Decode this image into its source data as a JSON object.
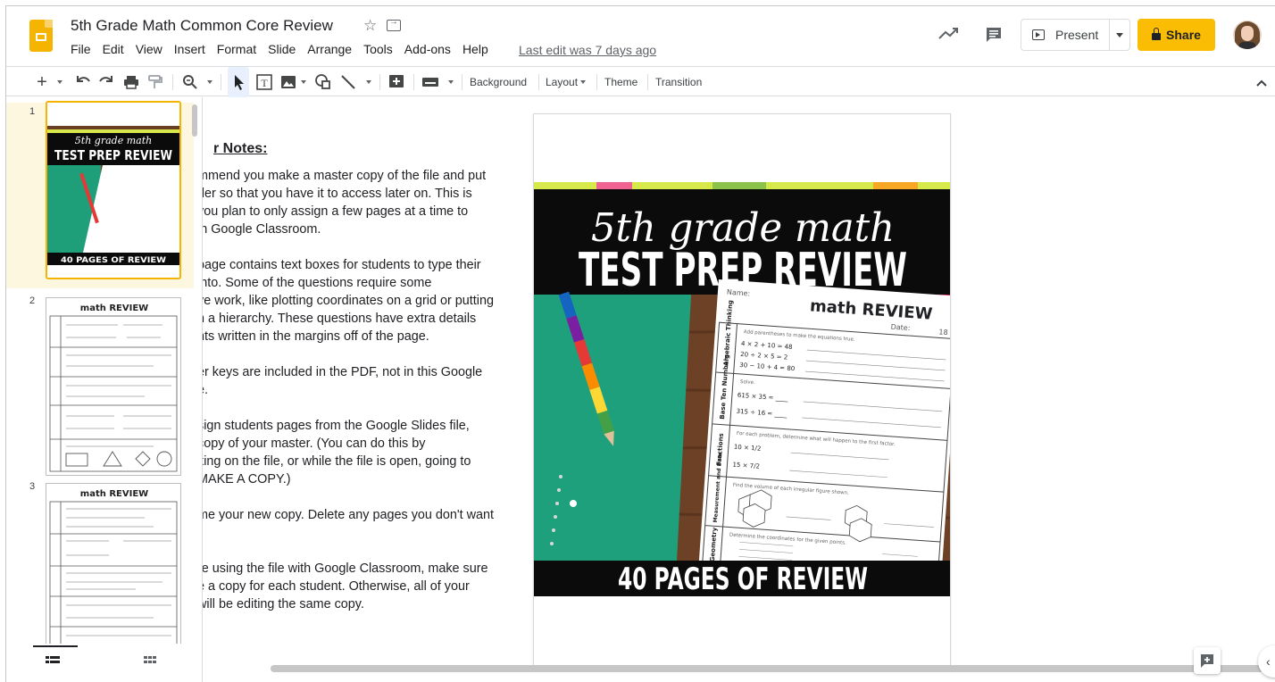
{
  "header": {
    "doc_title": "5th Grade Math Common Core Review",
    "menu": [
      "File",
      "Edit",
      "View",
      "Insert",
      "Format",
      "Slide",
      "Arrange",
      "Tools",
      "Add-ons",
      "Help"
    ],
    "last_edit": "Last edit was 7 days ago",
    "present_label": "Present",
    "share_label": "Share",
    "accent_color": "#fbbc04"
  },
  "toolbar": {
    "background_label": "Background",
    "layout_label": "Layout",
    "theme_label": "Theme",
    "transition_label": "Transition"
  },
  "filmstrip": {
    "slides": [
      {
        "number": "1",
        "thumb_title_1": "5th grade math",
        "thumb_title_2": "TEST PREP REVIEW",
        "thumb_footer": "40 PAGES OF REVIEW"
      },
      {
        "number": "2",
        "thumb_title": "math REVIEW"
      },
      {
        "number": "3",
        "thumb_title": "math REVIEW"
      }
    ]
  },
  "notes": {
    "title": "r Notes:",
    "paragraphs": [
      "mmend you make a master copy of the file and put\nder so that you have it to access later on. This is\n you plan to only assign a few pages at a time to\n in Google Classroom.",
      "page contains text boxes for students to type their\n into. Some of the questions require some\nve work, like plotting coordinates on a grid or putting\nn a hierarchy. These questions have extra details\nnts written in the margins off of the page.",
      "er keys are included in the PDF, not in this Google\ne.",
      "sign students pages from the Google Slides file,\ncopy of your master. (You can do this by\nking on the file, or while the file is open, going to\nMAKE A COPY.)",
      "me your new copy. Delete any pages you don't want\n.",
      "re using the file with Google Classroom, make sure\ne a copy for each student. Otherwise, all of your\n will be editing the same copy."
    ]
  },
  "slide": {
    "script_title": "5th grade math",
    "headline": "TEST PREP REVIEW",
    "footer": "40 PAGES OF REVIEW",
    "worksheet": {
      "name_label": "Name:",
      "date_label": "Date:",
      "page_number": "18",
      "title": "math REVIEW",
      "sections": [
        {
          "label": "Algebraic Thinking",
          "prompt": "Add parentheses to make the equations true.",
          "items": [
            "4 × 2 + 10 = 48",
            "20 ÷ 2 × 5 = 2",
            "30 − 10 + 4 = 80"
          ]
        },
        {
          "label": "Base Ten Numbers",
          "prompt": "Solve.",
          "items": [
            "615 × 35 = ____",
            "315 ÷ 16 = ____"
          ]
        },
        {
          "label": "Fractions",
          "prompt": "For each problem, determine what will happen to the first factor.",
          "items": [
            "10 × 1/2",
            "15 × 7/2"
          ]
        },
        {
          "label": "Measurement and Data",
          "prompt": "Find the volume of each irregular figure shown.",
          "items": []
        },
        {
          "label": "Geometry",
          "prompt": "Determine the coordinates for the given points.",
          "items": []
        }
      ]
    }
  }
}
